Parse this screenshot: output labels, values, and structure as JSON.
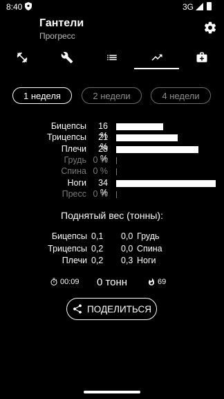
{
  "status_bar": {
    "time": "8:40",
    "network": "3G"
  },
  "header": {
    "title": "Гантели",
    "subtitle": "Прогресс"
  },
  "tabs": [
    {
      "icon": "dumbbell-icon"
    },
    {
      "icon": "wrench-icon"
    },
    {
      "icon": "list-icon"
    },
    {
      "icon": "trending-up-icon",
      "active": true
    },
    {
      "icon": "briefcase-plus-icon"
    }
  ],
  "week_filters": [
    "1 неделя",
    "2 недели",
    "4 недели"
  ],
  "muscle_groups": [
    {
      "name": "Бицепсы",
      "percent": "16 %",
      "value": 16
    },
    {
      "name": "Трицепсы",
      "percent": "21 %",
      "value": 21
    },
    {
      "name": "Плечи",
      "percent": "28 %",
      "value": 28
    },
    {
      "name": "Грудь",
      "percent": "0 %",
      "value": 0
    },
    {
      "name": "Спина",
      "percent": "0 %",
      "value": 0
    },
    {
      "name": "Ноги",
      "percent": "34 %",
      "value": 34
    },
    {
      "name": "Пресс",
      "percent": "0 %",
      "value": 0
    }
  ],
  "weight": {
    "title": "Поднятый вес (тонны):",
    "rows": [
      {
        "left_name": "Бицепсы",
        "left_value": "0,1",
        "right_value": "0,0",
        "right_name": "Грудь"
      },
      {
        "left_name": "Трицепсы",
        "left_value": "0,2",
        "right_value": "0,0",
        "right_name": "Спина"
      },
      {
        "left_name": "Плечи",
        "left_value": "0,2",
        "right_value": "0,3",
        "right_name": "Ноги"
      }
    ]
  },
  "stats": {
    "duration": "00:09",
    "total": "0 тонн",
    "calories": "69"
  },
  "share": {
    "label": "ПОДЕЛИТЬСЯ"
  },
  "colors": {
    "background": "#000000",
    "foreground": "#ffffff",
    "dim": "#7a7a7a"
  }
}
